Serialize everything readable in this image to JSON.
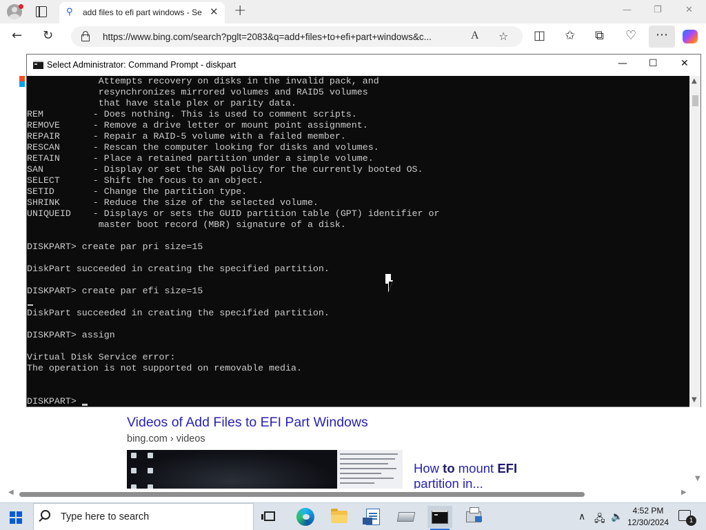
{
  "browser": {
    "tab": {
      "title": "add files to efi part windows - Se",
      "favicon": "search-icon",
      "close": "✕"
    },
    "new_tab": "+",
    "window_controls": {
      "minimize": "—",
      "restore": "❐",
      "close": "✕"
    },
    "address_bar": {
      "url": "https://www.bing.com/search?pglt=2083&q=add+files+to+efi+part+windows&c...",
      "read_aloud_icon": "A",
      "favorite_icon": "☆"
    },
    "toolbar": {
      "back_icon": "←",
      "refresh_icon": "↻",
      "split_screen_icon": "◫",
      "favorites_icon": "✩",
      "collections_icon": "⧉",
      "browser_essentials_icon": "♡",
      "menu_icon": "⋯"
    }
  },
  "page": {
    "video_section_title": "Videos of Add Files to EFI Part Windows",
    "video_source": "bing.com › videos",
    "side_card_title_pre": "How ",
    "side_card_title_bold1": "to",
    "side_card_title_mid": " mount ",
    "side_card_title_bold2": "EFI",
    "side_card_title_post": " partition in..."
  },
  "cmd_window": {
    "title": "Select Administrator: Command Prompt - diskpart",
    "controls": {
      "minimize": "—",
      "maximize": "☐",
      "close": "✕"
    },
    "lines": [
      "             Attempts recovery on disks in the invalid pack, and",
      "             resynchronizes mirrored volumes and RAID5 volumes",
      "             that have stale plex or parity data.",
      "REM         - Does nothing. This is used to comment scripts.",
      "REMOVE      - Remove a drive letter or mount point assignment.",
      "REPAIR      - Repair a RAID-5 volume with a failed member.",
      "RESCAN      - Rescan the computer looking for disks and volumes.",
      "RETAIN      - Place a retained partition under a simple volume.",
      "SAN         - Display or set the SAN policy for the currently booted OS.",
      "SELECT      - Shift the focus to an object.",
      "SETID       - Change the partition type.",
      "SHRINK      - Reduce the size of the selected volume.",
      "UNIQUEID    - Displays or sets the GUID partition table (GPT) identifier or",
      "             master boot record (MBR) signature of a disk.",
      "",
      "DISKPART> create par pri size=15",
      "",
      "DiskPart succeeded in creating the specified partition.",
      "",
      "DISKPART> create par efi size=15",
      "",
      "DiskPart succeeded in creating the specified partition.",
      "",
      "DISKPART> assign",
      "",
      "Virtual Disk Service error:",
      "The operation is not supported on removable media.",
      "",
      ""
    ],
    "prompt": "DISKPART> "
  },
  "taskbar": {
    "search_placeholder": "Type here to search",
    "apps": [
      "task-view",
      "edge",
      "file-explorer",
      "notepad",
      "drive",
      "command-prompt",
      "printer"
    ],
    "tray": {
      "chevron": "∧",
      "network_icon": "🖧",
      "volume_icon": "🔈",
      "time": "4:52 PM",
      "date": "12/30/2024",
      "notification_count": "1"
    }
  },
  "colors": {
    "console_bg": "#0c0c0c",
    "console_fg": "#cccccc",
    "link": "#2823b6",
    "taskbar": "#dde3ea",
    "accent": "#2b74d8"
  }
}
